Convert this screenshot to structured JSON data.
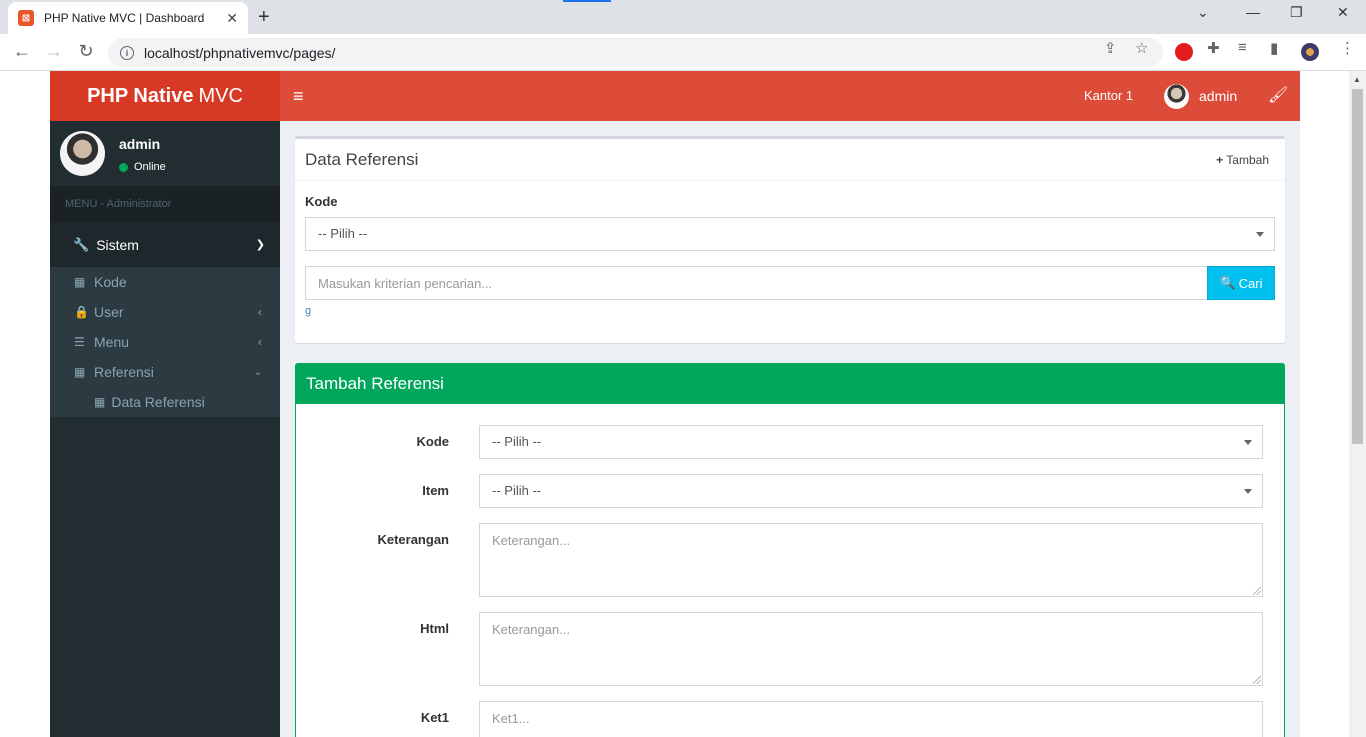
{
  "browser": {
    "tab_title": "PHP Native MVC | Dashboard",
    "url": "localhost/phpnativemvc/pages/"
  },
  "header": {
    "logo_bold": "PHP Native",
    "logo_light": "MVC",
    "office": "Kantor 1",
    "username": "admin"
  },
  "sidebar": {
    "user_name": "admin",
    "user_status": "Online",
    "menu_header": "MENU - Administrator",
    "section": "Sistem",
    "items": [
      {
        "label": "Kode"
      },
      {
        "label": "User"
      },
      {
        "label": "Menu"
      },
      {
        "label": "Referensi"
      }
    ],
    "sub_item": "Data Referensi"
  },
  "box1": {
    "title": "Data Referensi",
    "add_label": "Tambah",
    "kode_label": "Kode",
    "kode_select": "-- Pilih --",
    "search_placeholder": "Masukan kriterian pencarian...",
    "search_button": "Cari",
    "link": "g"
  },
  "box2": {
    "title": "Tambah Referensi",
    "kode_label": "Kode",
    "kode_select": "-- Pilih --",
    "item_label": "Item",
    "item_select": "-- Pilih --",
    "keterangan_label": "Keterangan",
    "keterangan_placeholder": "Keterangan...",
    "html_label": "Html",
    "html_placeholder": "Keterangan...",
    "ket1_label": "Ket1",
    "ket1_placeholder": "Ket1..."
  },
  "colors": {
    "header": "#dd4b39",
    "sidebar": "#222d32",
    "success": "#00a65a",
    "info": "#00c0ef"
  }
}
